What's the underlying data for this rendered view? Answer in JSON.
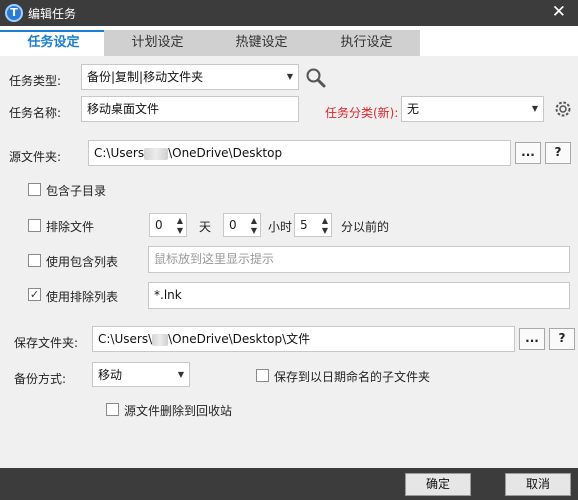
{
  "window": {
    "title": "编辑任务",
    "icon_letter": "T",
    "close_glyph": "✕"
  },
  "tabs": [
    {
      "label": "任务设定",
      "active": true
    },
    {
      "label": "计划设定",
      "active": false
    },
    {
      "label": "热键设定",
      "active": false
    },
    {
      "label": "执行设定",
      "active": false
    }
  ],
  "form": {
    "task_type_label": "任务类型:",
    "task_type_value": "备份|复制|移动文件夹",
    "task_name_label": "任务名称:",
    "task_name_value": "移动桌面文件",
    "category_label": "任务分类(新):",
    "category_value": "无",
    "source_label": "源文件夹:",
    "source_prefix": "C:\\Users",
    "source_suffix": "\\OneDrive\\Desktop",
    "browse_label": "...",
    "help_label": "?",
    "include_subdirs_label": "包含子目录",
    "exclude_files_label": "排除文件",
    "days_value": "0",
    "days_unit": "天",
    "hours_value": "0",
    "hours_unit": "小时",
    "minutes_value": "5",
    "minutes_unit": "分以前的",
    "use_include_list_label": "使用包含列表",
    "include_list_placeholder": "鼠标放到这里显示提示",
    "use_exclude_list_label": "使用排除列表",
    "exclude_list_value": "*.lnk",
    "exclude_checked_glyph": "✓",
    "save_label": "保存文件夹:",
    "save_prefix": "C:\\Users\\",
    "save_suffix": "\\OneDrive\\Desktop\\文件",
    "backup_mode_label": "备份方式:",
    "backup_mode_value": "移动",
    "save_dated_subfolder_label": "保存到以日期命名的子文件夹",
    "delete_to_recycle_label": "源文件删除到回收站"
  },
  "icons": {
    "search": "search-icon",
    "gear": "gear-icon"
  },
  "footer": {
    "ok_label": "确定",
    "cancel_label": "取消"
  },
  "colors": {
    "accent": "#1a7ed6",
    "titlebar": "#3c3c3c",
    "required": "#e0262b"
  }
}
